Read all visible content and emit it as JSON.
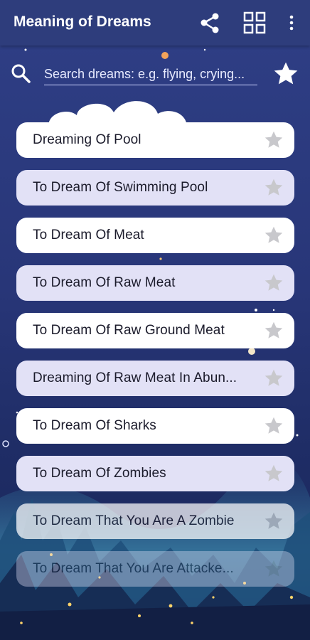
{
  "appbar": {
    "title": "Meaning of Dreams",
    "icons": [
      "share-icon",
      "grid-icon",
      "more-vert-icon"
    ]
  },
  "search": {
    "placeholder": "Search dreams: e.g. flying, crying...",
    "icon": "search-icon",
    "favorite_icon": "star-icon"
  },
  "items": [
    {
      "label": "Dreaming Of Pool",
      "style": "white"
    },
    {
      "label": "To Dream Of Swimming Pool",
      "style": "lavender"
    },
    {
      "label": "To Dream Of Meat",
      "style": "white"
    },
    {
      "label": "To Dream Of Raw Meat",
      "style": "lavender"
    },
    {
      "label": "To Dream Of Raw Ground Meat",
      "style": "white"
    },
    {
      "label": "Dreaming Of Raw Meat In Abun...",
      "style": "lavender"
    },
    {
      "label": "To Dream Of Sharks",
      "style": "white"
    },
    {
      "label": "To Dream Of Zombies",
      "style": "lavender"
    },
    {
      "label": "To Dream That You Are A Zombie",
      "style": "white"
    },
    {
      "label": "To Dream That You Are Attacke...",
      "style": "lavender"
    }
  ],
  "colors": {
    "appbar": "#2e3d7c",
    "background": "#283678",
    "item_white": "#ffffff",
    "item_lavender": "#e2e1f6",
    "star_inactive": "#c8c8cc"
  }
}
